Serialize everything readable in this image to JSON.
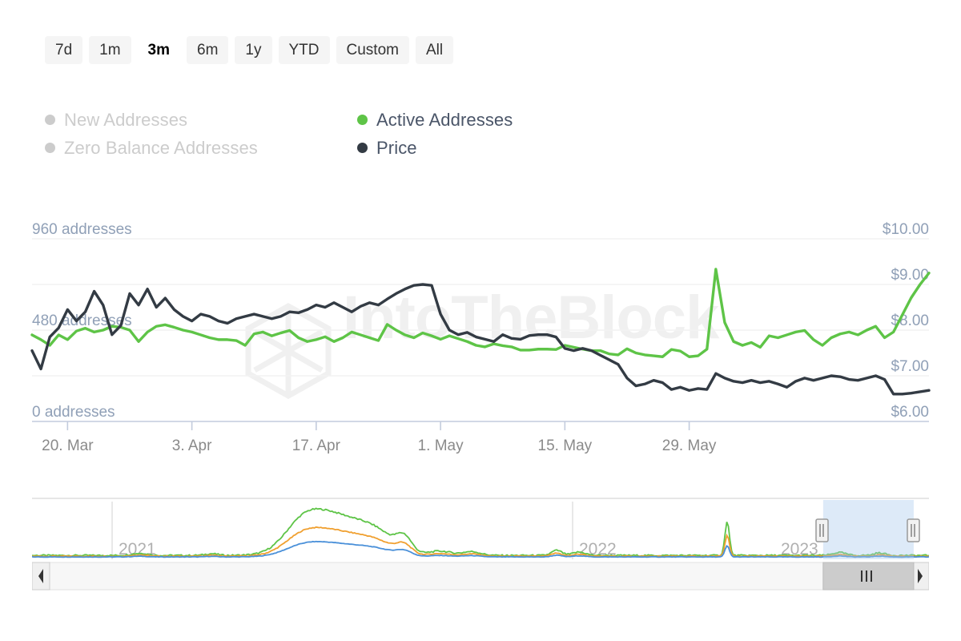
{
  "range_selector": {
    "options": [
      {
        "label": "7d",
        "selected": false
      },
      {
        "label": "1m",
        "selected": false
      },
      {
        "label": "3m",
        "selected": true
      },
      {
        "label": "6m",
        "selected": false
      },
      {
        "label": "1y",
        "selected": false
      },
      {
        "label": "YTD",
        "selected": false
      },
      {
        "label": "Custom",
        "selected": false
      },
      {
        "label": "All",
        "selected": false
      }
    ]
  },
  "legend": {
    "items": [
      {
        "label": "New Addresses",
        "color": "#cccccc",
        "active": false
      },
      {
        "label": "Active Addresses",
        "color": "#5ec447",
        "active": true
      },
      {
        "label": "Zero Balance Addresses",
        "color": "#cccccc",
        "active": false
      },
      {
        "label": "Price",
        "color": "#333b44",
        "active": true
      }
    ]
  },
  "watermark": {
    "text": "IntoTheBlock",
    "logo": "intotheblock-hexagon-logo"
  },
  "chart_data": {
    "type": "line",
    "title": "",
    "xlabel": "",
    "ylabel": "addresses",
    "grid": true,
    "legend_position": "top-left",
    "y_left": {
      "label": "addresses",
      "ticks": [
        "0 addresses",
        "480 addresses",
        "960 addresses"
      ],
      "tick_values": [
        0,
        480,
        960
      ],
      "ylim": [
        0,
        960
      ]
    },
    "y_right": {
      "label": "price",
      "ticks": [
        "$6.00",
        "$7.00",
        "$8.00",
        "$9.00",
        "$10.00"
      ],
      "tick_values": [
        6,
        7,
        8,
        9,
        10
      ],
      "ylim": [
        6,
        10
      ]
    },
    "x_ticks": [
      "20. Mar",
      "3. Apr",
      "17. Apr",
      "1. May",
      "15. May",
      "29. May"
    ],
    "series": [
      {
        "name": "Active Addresses",
        "color": "#5ec447",
        "axis": "left",
        "unit": "addresses",
        "values": [
          455,
          430,
          400,
          455,
          430,
          475,
          490,
          470,
          480,
          500,
          495,
          480,
          420,
          470,
          500,
          508,
          495,
          480,
          470,
          455,
          440,
          430,
          430,
          425,
          400,
          460,
          470,
          450,
          465,
          478,
          440,
          420,
          430,
          445,
          420,
          440,
          470,
          455,
          440,
          425,
          510,
          480,
          455,
          440,
          465,
          450,
          432,
          450,
          435,
          420,
          400,
          392,
          408,
          398,
          392,
          375,
          375,
          380,
          380,
          378,
          400,
          390,
          380,
          372,
          372,
          355,
          350,
          382,
          360,
          350,
          345,
          340,
          378,
          370,
          340,
          345,
          380,
          800,
          520,
          420,
          400,
          415,
          390,
          450,
          440,
          455,
          470,
          478,
          430,
          400,
          440,
          460,
          470,
          455,
          480,
          500,
          440,
          470,
          560,
          650,
          720,
          780
        ]
      },
      {
        "name": "Price",
        "color": "#333b44",
        "axis": "right",
        "unit": "USD",
        "values": [
          7.55,
          7.15,
          7.85,
          8.05,
          8.45,
          8.2,
          8.4,
          8.85,
          8.55,
          7.9,
          8.1,
          8.8,
          8.55,
          8.9,
          8.5,
          8.7,
          8.45,
          8.3,
          8.2,
          8.35,
          8.3,
          8.2,
          8.15,
          8.25,
          8.3,
          8.35,
          8.3,
          8.25,
          8.3,
          8.4,
          8.38,
          8.45,
          8.55,
          8.5,
          8.6,
          8.5,
          8.4,
          8.52,
          8.6,
          8.55,
          8.68,
          8.8,
          8.9,
          8.98,
          9.0,
          8.98,
          8.35,
          8.0,
          7.9,
          7.95,
          7.85,
          7.8,
          7.75,
          7.9,
          7.82,
          7.8,
          7.88,
          7.9,
          7.9,
          7.85,
          7.6,
          7.55,
          7.6,
          7.55,
          7.45,
          7.35,
          7.25,
          6.95,
          6.78,
          6.82,
          6.9,
          6.85,
          6.7,
          6.75,
          6.68,
          6.72,
          6.7,
          7.05,
          6.95,
          6.88,
          6.85,
          6.9,
          6.85,
          6.88,
          6.82,
          6.75,
          6.88,
          6.95,
          6.9,
          6.95,
          7.0,
          6.98,
          6.92,
          6.9,
          6.95,
          7.0,
          6.92,
          6.6,
          6.6,
          6.62,
          6.65,
          6.68
        ]
      }
    ]
  },
  "navigator": {
    "year_labels": [
      "2021",
      "2022",
      "2023"
    ],
    "series": [
      {
        "name": "Active Addresses",
        "color": "#5ec447"
      },
      {
        "name": "New Addresses",
        "color": "#f0a030"
      },
      {
        "name": "Zero Balance Addresses",
        "color": "#4a90d9"
      }
    ],
    "selection": {
      "start_pct": 88.2,
      "end_pct": 98.3
    },
    "handle_left": "navigator-handle-left",
    "handle_right": "navigator-handle-right"
  },
  "scrollbar": {
    "left_arrow": "◂",
    "right_arrow": "▸",
    "thumb_grip": "|||",
    "thumb_start_pct": 88.2,
    "thumb_end_pct": 98.3
  }
}
